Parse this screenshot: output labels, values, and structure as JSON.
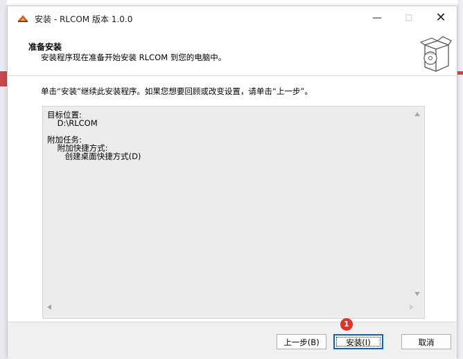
{
  "window": {
    "title": "安装 - RLCOM 版本 1.0.0",
    "controls": {
      "minimize": "—",
      "maximize": "☐",
      "close": "✕"
    }
  },
  "header": {
    "title": "准备安装",
    "subtitle": "安装程序现在准备开始安装 RLCOM 到您的电脑中。",
    "icon": "install-box-disc-icon"
  },
  "instruction": "单击“安装”继续此安装程序。如果您想要回顾或改变设置，请单击“上一步”。",
  "summary": {
    "text": "目标位置:\n    D:\\RLCOM\n\n附加任务:\n    附加快捷方式:\n       创建桌面快捷方式(D)"
  },
  "buttons": {
    "back": "上一步(B)",
    "install": "安装(I)",
    "cancel": "取消"
  },
  "annotation": {
    "badge": "1"
  },
  "colors": {
    "accent": "#0067c0",
    "badge": "#e0312b",
    "memo_bg": "#ececec"
  }
}
